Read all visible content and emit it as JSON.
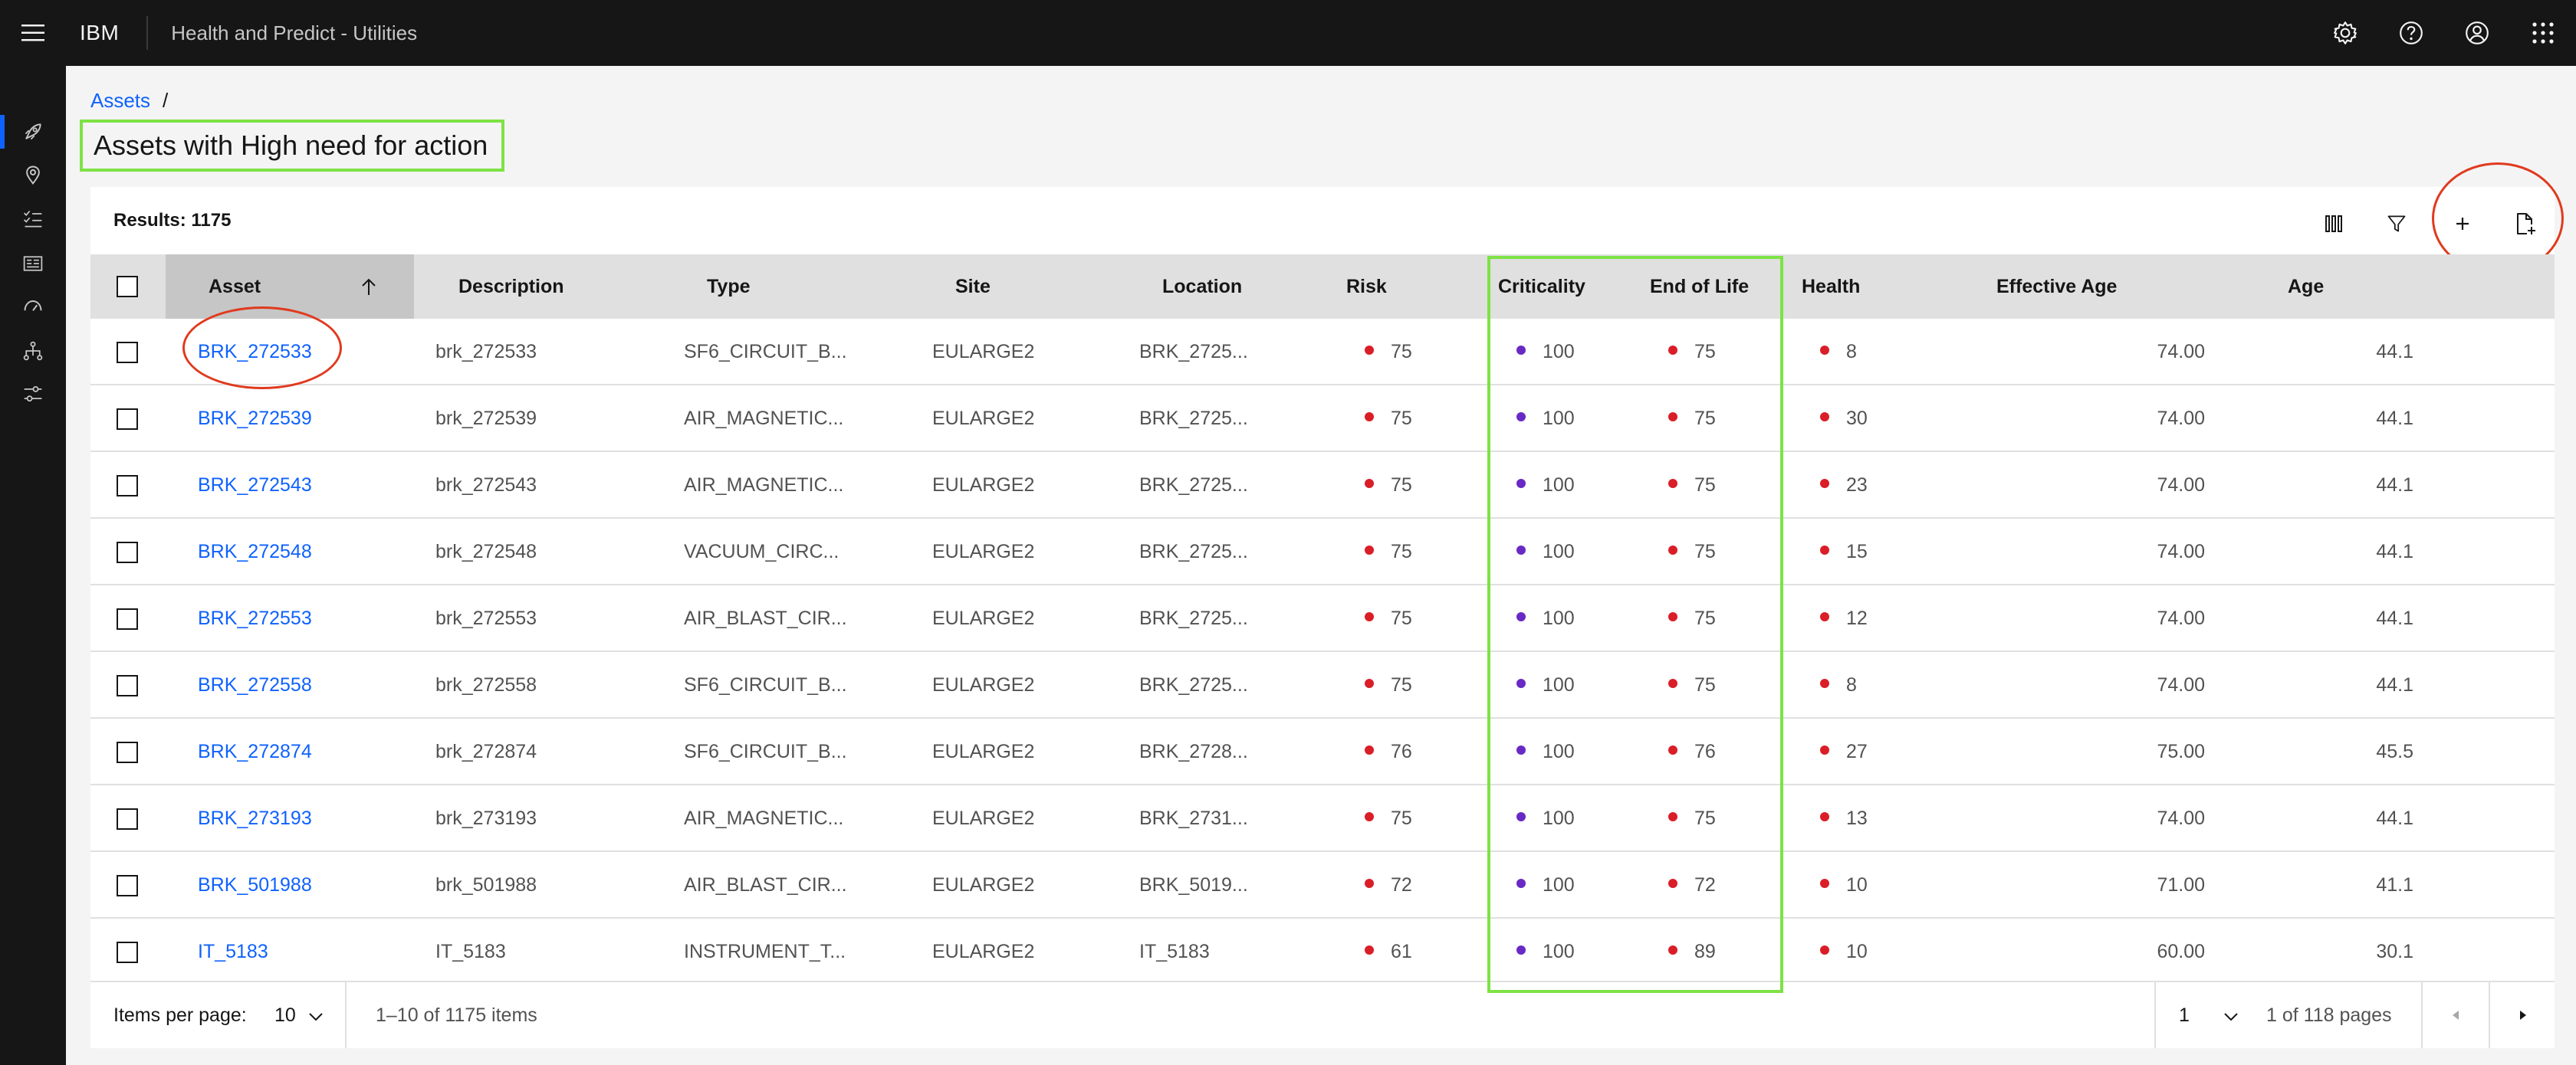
{
  "header": {
    "menu_icon": "hamburger-menu-icon",
    "brand": "IBM",
    "app_name": "Health and Predict - Utilities",
    "actions": [
      "settings-icon",
      "help-icon",
      "user-avatar-icon",
      "app-switcher-icon"
    ]
  },
  "sidenav": {
    "items": [
      "rocket-icon",
      "location-icon",
      "checklist-icon",
      "dashboard-icon",
      "meter-icon",
      "hierarchy-icon",
      "settings-adjust-icon"
    ],
    "active_index": 0
  },
  "breadcrumb": {
    "link": "Assets",
    "separator": "/"
  },
  "page_title": "Assets with High need for action",
  "toolbar": {
    "results": "Results: 1175",
    "buttons": [
      "column-settings-icon",
      "filter-icon",
      "add-icon",
      "document-add-icon"
    ]
  },
  "table": {
    "headers": {
      "asset": "Asset",
      "description": "Description",
      "type": "Type",
      "site": "Site",
      "location": "Location",
      "risk": "Risk",
      "criticality": "Criticality",
      "end_of_life": "End of Life",
      "health": "Health",
      "effective_age": "Effective Age",
      "age": "Age"
    },
    "sort_icon": "arrow-up-icon",
    "rows": [
      {
        "asset": "BRK_272533",
        "description": "brk_272533",
        "type": "SF6_CIRCUIT_B...",
        "site": "EULARGE2",
        "location": "BRK_2725...",
        "risk": "75",
        "criticality": "100",
        "end_of_life": "75",
        "health": "8",
        "effective_age": "74.00",
        "age": "44.1"
      },
      {
        "asset": "BRK_272539",
        "description": "brk_272539",
        "type": "AIR_MAGNETIC...",
        "site": "EULARGE2",
        "location": "BRK_2725...",
        "risk": "75",
        "criticality": "100",
        "end_of_life": "75",
        "health": "30",
        "effective_age": "74.00",
        "age": "44.1"
      },
      {
        "asset": "BRK_272543",
        "description": "brk_272543",
        "type": "AIR_MAGNETIC...",
        "site": "EULARGE2",
        "location": "BRK_2725...",
        "risk": "75",
        "criticality": "100",
        "end_of_life": "75",
        "health": "23",
        "effective_age": "74.00",
        "age": "44.1"
      },
      {
        "asset": "BRK_272548",
        "description": "brk_272548",
        "type": "VACUUM_CIRC...",
        "site": "EULARGE2",
        "location": "BRK_2725...",
        "risk": "75",
        "criticality": "100",
        "end_of_life": "75",
        "health": "15",
        "effective_age": "74.00",
        "age": "44.1"
      },
      {
        "asset": "BRK_272553",
        "description": "brk_272553",
        "type": "AIR_BLAST_CIR...",
        "site": "EULARGE2",
        "location": "BRK_2725...",
        "risk": "75",
        "criticality": "100",
        "end_of_life": "75",
        "health": "12",
        "effective_age": "74.00",
        "age": "44.1"
      },
      {
        "asset": "BRK_272558",
        "description": "brk_272558",
        "type": "SF6_CIRCUIT_B...",
        "site": "EULARGE2",
        "location": "BRK_2725...",
        "risk": "75",
        "criticality": "100",
        "end_of_life": "75",
        "health": "8",
        "effective_age": "74.00",
        "age": "44.1"
      },
      {
        "asset": "BRK_272874",
        "description": "brk_272874",
        "type": "SF6_CIRCUIT_B...",
        "site": "EULARGE2",
        "location": "BRK_2728...",
        "risk": "76",
        "criticality": "100",
        "end_of_life": "76",
        "health": "27",
        "effective_age": "75.00",
        "age": "45.5"
      },
      {
        "asset": "BRK_273193",
        "description": "brk_273193",
        "type": "AIR_MAGNETIC...",
        "site": "EULARGE2",
        "location": "BRK_2731...",
        "risk": "75",
        "criticality": "100",
        "end_of_life": "75",
        "health": "13",
        "effective_age": "74.00",
        "age": "44.1"
      },
      {
        "asset": "BRK_501988",
        "description": "brk_501988",
        "type": "AIR_BLAST_CIR...",
        "site": "EULARGE2",
        "location": "BRK_5019...",
        "risk": "72",
        "criticality": "100",
        "end_of_life": "72",
        "health": "10",
        "effective_age": "71.00",
        "age": "41.1"
      },
      {
        "asset": "IT_5183",
        "description": "IT_5183",
        "type": "INSTRUMENT_T...",
        "site": "EULARGE2",
        "location": "IT_5183",
        "risk": "61",
        "criticality": "100",
        "end_of_life": "89",
        "health": "10",
        "effective_age": "60.00",
        "age": "30.1"
      }
    ]
  },
  "pagination": {
    "items_per_page_label": "Items per page:",
    "items_per_page_value": "10",
    "range": "1–10 of 1175 items",
    "page_value": "1",
    "page_total": "1 of 118 pages",
    "prev_icon": "caret-left-icon",
    "next_icon": "caret-right-icon",
    "dropdown_icon": "chevron-down-icon"
  },
  "colors": {
    "header_bg": "#161616",
    "link": "#0f62fe",
    "status_red": "#da1e28",
    "status_purple": "#6929c4",
    "highlight_green": "#7ee245",
    "annotation_red": "#e03a1e"
  }
}
